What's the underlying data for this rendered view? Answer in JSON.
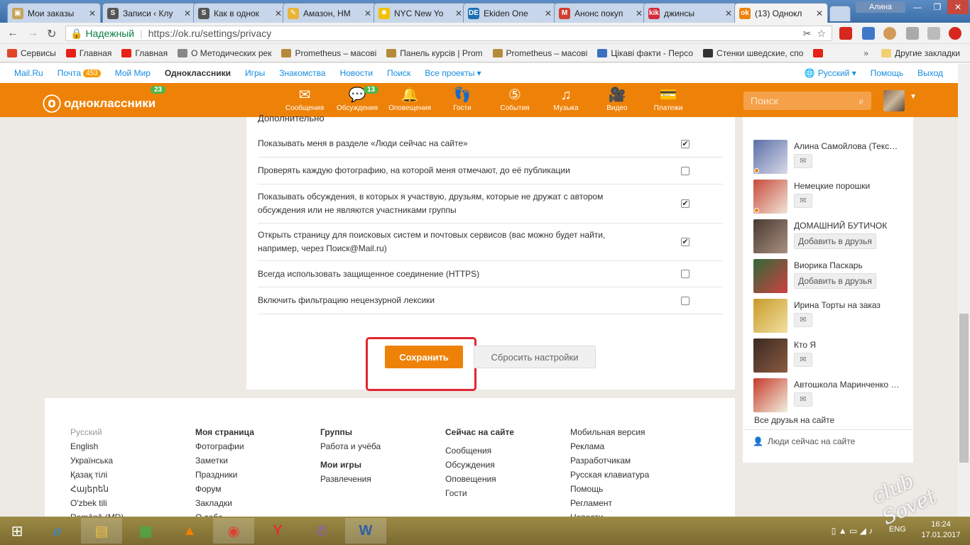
{
  "browser": {
    "tabs": [
      {
        "title": "Мои заказы",
        "color": "#c8a35a",
        "glyph": "▣"
      },
      {
        "title": "Записи ‹ Клу",
        "color": "#555555",
        "glyph": "S"
      },
      {
        "title": "Как в однок",
        "color": "#555555",
        "glyph": "S"
      },
      {
        "title": "Амазон, НМ",
        "color": "#e9b43a",
        "glyph": "✎"
      },
      {
        "title": "NYC New Yo",
        "color": "#f2c200",
        "glyph": "✺"
      },
      {
        "title": "Ekiden One",
        "color": "#1b6fb5",
        "glyph": "DE"
      },
      {
        "title": "Анонс покуп",
        "color": "#d23f31",
        "glyph": "M"
      },
      {
        "title": "джинсы",
        "color": "#d52b3b",
        "glyph": "kik"
      },
      {
        "title": "(13) Однокл",
        "color": "#ee8208",
        "glyph": "ok"
      }
    ],
    "user": "Алина",
    "address": {
      "secure_label": "Надежный",
      "url": "https://ok.ru/settings/privacy"
    },
    "bookmarks": [
      {
        "label": "Сервисы",
        "color": "#e0452a"
      },
      {
        "label": "Главная",
        "color": "#e62117"
      },
      {
        "label": "Главная",
        "color": "#e62117"
      },
      {
        "label": "О Методических рек",
        "color": "#888888"
      },
      {
        "label": "Prometheus – масові",
        "color": "#b58a3a"
      },
      {
        "label": "Панель курсів | Prom",
        "color": "#b58a3a"
      },
      {
        "label": "Prometheus – масові",
        "color": "#b58a3a"
      },
      {
        "label": "Цікаві факти - Персо",
        "color": "#3b6fc0"
      },
      {
        "label": "Стенки шведские, спо",
        "color": "#333333"
      }
    ],
    "other_bookmarks": "Другие закладки",
    "more": "»"
  },
  "mailru": {
    "links": [
      "Mail.Ru",
      "Почта",
      "Мой Мир",
      "Одноклассники",
      "Игры",
      "Знакомства",
      "Новости",
      "Поиск",
      "Все проекты ▾"
    ],
    "mail_count": "453",
    "lang": "Русский ▾",
    "help": "Помощь",
    "logout": "Выход"
  },
  "okheader": {
    "logo": "одноклассники",
    "logo_badge": "23",
    "nav": [
      {
        "label": "Сообщения",
        "icon": "✉",
        "name": "messages-icon"
      },
      {
        "label": "Обсуждения",
        "icon": "💬",
        "name": "discussions-icon",
        "badge": "13"
      },
      {
        "label": "Оповещения",
        "icon": "🔔",
        "name": "bell-icon"
      },
      {
        "label": "Гости",
        "icon": "👣",
        "name": "footprints-icon"
      },
      {
        "label": "События",
        "icon": "⑤",
        "name": "events-icon"
      },
      {
        "label": "Музыка",
        "icon": "♫",
        "name": "music-icon"
      },
      {
        "label": "Видео",
        "icon": "🎥",
        "name": "video-icon"
      },
      {
        "label": "Платежи",
        "icon": "💳",
        "name": "wallet-icon"
      }
    ],
    "search_placeholder": "Поиск"
  },
  "settings": {
    "section_title": "Дополнительно",
    "rows": [
      {
        "label": "Показывать меня в разделе «Люди сейчас на сайте»",
        "checked": true
      },
      {
        "label": "Проверять каждую фотографию, на которой меня отмечают, до её публикации",
        "checked": false
      },
      {
        "label": "Показывать обсуждения, в которых я участвую, друзьям, которые не дружат с автором обсуждения или не являются участниками группы",
        "checked": true
      },
      {
        "label": "Открыть страницу для поисковых систем и почтовых сервисов (вас можно будет найти, например, через Поиск@Mail.ru)",
        "checked": true
      },
      {
        "label": "Всегда использовать защищенное соединение (HTTPS)",
        "checked": false
      },
      {
        "label": "Включить фильтрацию нецензурной лексики",
        "checked": false
      }
    ],
    "save": "Сохранить",
    "reset": "Сбросить настройки"
  },
  "friends": {
    "list": [
      {
        "name": "Алина Самойлова (Текс…",
        "action": "msg",
        "online": true,
        "c1": "#5a6fa8",
        "c2": "#d9d9e8"
      },
      {
        "name": "Немецкие порошки",
        "action": "msg",
        "online": true,
        "c1": "#c84a3b",
        "c2": "#f0e6d8"
      },
      {
        "name": "ДОМАШНИЙ БУТИЧОК",
        "action": "add",
        "online": false,
        "c1": "#4a3a32",
        "c2": "#a89080"
      },
      {
        "name": "Виорика Паскарь",
        "action": "add",
        "online": false,
        "c1": "#2f6a3a",
        "c2": "#d04040"
      },
      {
        "name": "Ирина Торты на заказ",
        "action": "msg",
        "online": false,
        "c1": "#c89a2a",
        "c2": "#f2e0a0"
      },
      {
        "name": "Кто Я",
        "action": "msg",
        "online": false,
        "c1": "#3a2a22",
        "c2": "#8a5a40"
      },
      {
        "name": "Автошкола Маринченко …",
        "action": "msg",
        "online": false,
        "c1": "#c83a2a",
        "c2": "#f0f0e0"
      }
    ],
    "add_label": "Добавить в друзья",
    "msg_icon": "✉",
    "all_friends": "Все друзья на сайте",
    "people_online": "Люди сейчас на сайте"
  },
  "footer": {
    "languages": [
      "Русский",
      "English",
      "Українська",
      "Қазақ тілі",
      "Հայերեն",
      "O'zbek tili",
      "Română (MD)"
    ],
    "col2": {
      "title": "Моя страница",
      "links": [
        "Фотографии",
        "Заметки",
        "Праздники",
        "Форум",
        "Закладки",
        "О себе"
      ]
    },
    "col3": {
      "title": "Группы",
      "links": [
        "Работа и учёба"
      ],
      "title2": "Мои игры",
      "links2": [
        "Развлечения"
      ]
    },
    "col4": {
      "title": "Сейчас на сайте",
      "links": [
        "Сообщения",
        "Обсуждения",
        "Оповещения",
        "Гости"
      ]
    },
    "col5": {
      "links": [
        "Мобильная версия",
        "Реклама",
        "Разработчикам",
        "Русская клавиатура",
        "Помощь",
        "Регламент",
        "Новости"
      ]
    }
  },
  "taskbar": {
    "lang": "ENG",
    "time": "16:24",
    "date": "17.01.2017"
  }
}
